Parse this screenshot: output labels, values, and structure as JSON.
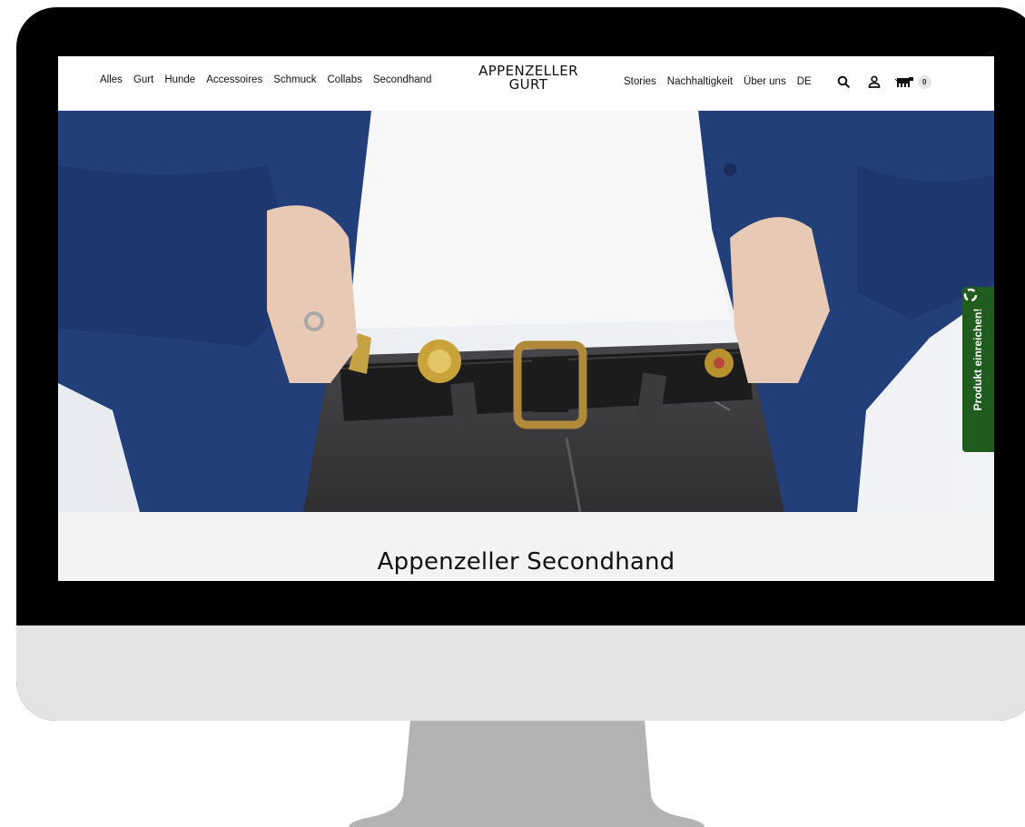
{
  "header": {
    "nav_left": [
      "Alles",
      "Gurt",
      "Hunde",
      "Accessoires",
      "Schmuck",
      "Collabs",
      "Secondhand"
    ],
    "logo_line1": "APPENZELLER",
    "logo_line2": "GURT",
    "nav_right": [
      "Stories",
      "Nachhaltigkeit",
      "Über uns",
      "DE"
    ],
    "cart_count": "0",
    "icons": [
      "search-icon",
      "user-icon",
      "cow-cart-icon"
    ]
  },
  "side_tab": {
    "label": "Produkt einreichen!",
    "icon": "recycle-icon",
    "color": "#1f5c1d"
  },
  "section": {
    "title": "Appenzeller Secondhand"
  },
  "colors": {
    "jacket": "#213f7a",
    "jeans": "#3a3a3c",
    "belt": "#1c1c1c",
    "brass": "#b08a3a"
  }
}
